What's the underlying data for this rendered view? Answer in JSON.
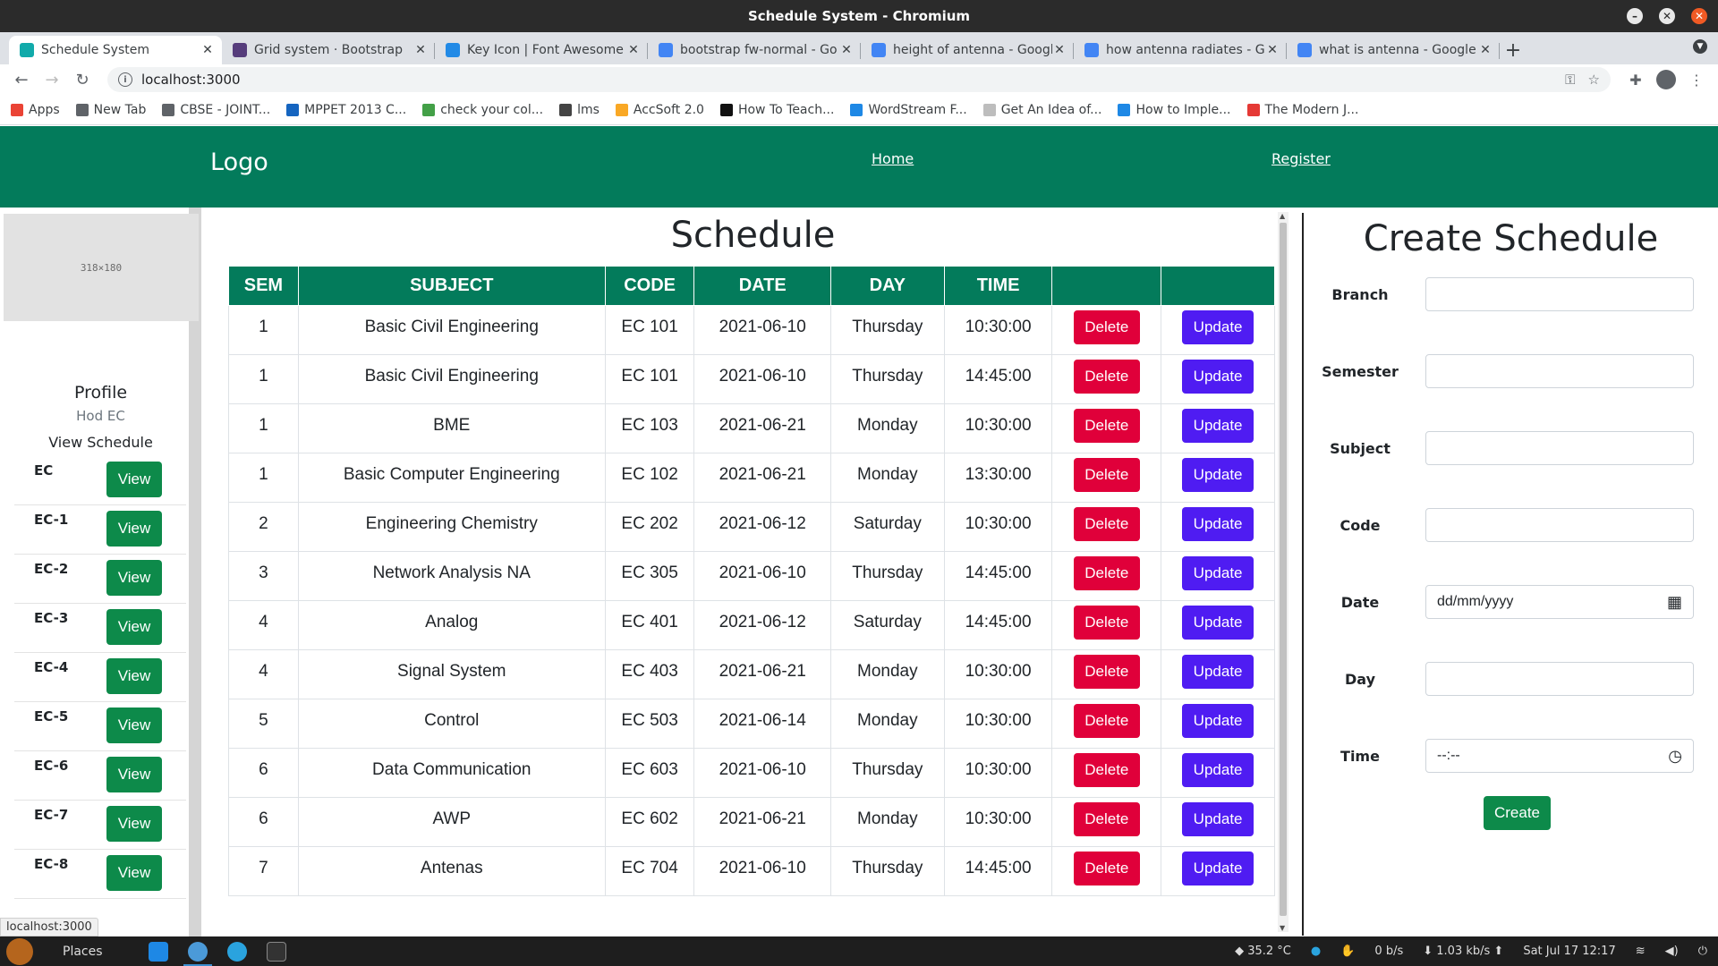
{
  "window": {
    "title": "Schedule System - Chromium"
  },
  "tabs": [
    {
      "label": "Schedule System",
      "favicon": "#1aa",
      "active": true
    },
    {
      "label": "Grid system · Bootstrap",
      "favicon": "#563d7c"
    },
    {
      "label": "Key Icon | Font Awesome",
      "favicon": "#228ae6"
    },
    {
      "label": "bootstrap fw-normal - Go",
      "favicon": "#4285f4"
    },
    {
      "label": "height of antenna - Googl",
      "favicon": "#4285f4"
    },
    {
      "label": "how antenna radiates - Go",
      "favicon": "#4285f4"
    },
    {
      "label": "what is antenna - Google",
      "favicon": "#4285f4"
    }
  ],
  "address": {
    "url": "localhost:3000"
  },
  "bookmarks": [
    {
      "label": "Apps",
      "color": "#ea4335"
    },
    {
      "label": "New Tab",
      "color": "#5f6368"
    },
    {
      "label": "CBSE - JOINT...",
      "color": "#5f6368"
    },
    {
      "label": "MPPET 2013 C...",
      "color": "#1565c0"
    },
    {
      "label": "check your col...",
      "color": "#43a047"
    },
    {
      "label": "lms",
      "color": "#444"
    },
    {
      "label": "AccSoft 2.0",
      "color": "#f9a825"
    },
    {
      "label": "How To Teach...",
      "color": "#111"
    },
    {
      "label": "WordStream F...",
      "color": "#1e88e5"
    },
    {
      "label": "Get An Idea of...",
      "color": "#bdbdbd"
    },
    {
      "label": "How to Imple...",
      "color": "#1e88e5"
    },
    {
      "label": "The Modern J...",
      "color": "#e53935"
    }
  ],
  "navbar": {
    "logo": "Logo",
    "home": "Home",
    "register": "Register"
  },
  "sidebar": {
    "placeholder": "318×180",
    "profile_title": "Profile",
    "profile_sub": "Hod EC",
    "view_schedule": "View Schedule",
    "items": [
      {
        "label": "EC",
        "button": "View"
      },
      {
        "label": "EC-1",
        "button": "View"
      },
      {
        "label": "EC-2",
        "button": "View"
      },
      {
        "label": "EC-3",
        "button": "View"
      },
      {
        "label": "EC-4",
        "button": "View"
      },
      {
        "label": "EC-5",
        "button": "View"
      },
      {
        "label": "EC-6",
        "button": "View"
      },
      {
        "label": "EC-7",
        "button": "View"
      },
      {
        "label": "EC-8",
        "button": "View"
      }
    ]
  },
  "schedule": {
    "title": "Schedule",
    "headers": [
      "SEM",
      "SUBJECT",
      "CODE",
      "DATE",
      "DAY",
      "TIME",
      "",
      ""
    ],
    "delete_label": "Delete",
    "update_label": "Update",
    "rows": [
      [
        "1",
        "Basic Civil Engineering",
        "EC 101",
        "2021-06-10",
        "Thursday",
        "10:30:00"
      ],
      [
        "1",
        "Basic Civil Engineering",
        "EC 101",
        "2021-06-10",
        "Thursday",
        "14:45:00"
      ],
      [
        "1",
        "BME",
        "EC 103",
        "2021-06-21",
        "Monday",
        "10:30:00"
      ],
      [
        "1",
        "Basic Computer Engineering",
        "EC 102",
        "2021-06-21",
        "Monday",
        "13:30:00"
      ],
      [
        "2",
        "Engineering Chemistry",
        "EC 202",
        "2021-06-12",
        "Saturday",
        "10:30:00"
      ],
      [
        "3",
        "Network Analysis NA",
        "EC 305",
        "2021-06-10",
        "Thursday",
        "14:45:00"
      ],
      [
        "4",
        "Analog",
        "EC 401",
        "2021-06-12",
        "Saturday",
        "14:45:00"
      ],
      [
        "4",
        "Signal System",
        "EC 403",
        "2021-06-21",
        "Monday",
        "10:30:00"
      ],
      [
        "5",
        "Control",
        "EC 503",
        "2021-06-14",
        "Monday",
        "10:30:00"
      ],
      [
        "6",
        "Data Communication",
        "EC 603",
        "2021-06-10",
        "Thursday",
        "10:30:00"
      ],
      [
        "6",
        "AWP",
        "EC 602",
        "2021-06-21",
        "Monday",
        "10:30:00"
      ],
      [
        "7",
        "Antenas",
        "EC 704",
        "2021-06-10",
        "Thursday",
        "14:45:00"
      ]
    ]
  },
  "form": {
    "title": "Create Schedule",
    "fields": [
      {
        "label": "Branch",
        "value": ""
      },
      {
        "label": "Semester",
        "value": ""
      },
      {
        "label": "Subject",
        "value": ""
      },
      {
        "label": "Code",
        "value": ""
      },
      {
        "label": "Date",
        "value": "dd/mm/yyyy",
        "icon": "calendar-icon"
      },
      {
        "label": "Day",
        "value": ""
      },
      {
        "label": "Time",
        "value": "--:--",
        "icon": "clock-icon"
      }
    ],
    "submit": "Create"
  },
  "status_tooltip": "localhost:3000",
  "taskbar": {
    "places": "Places",
    "temperature": "35.2 °C",
    "net_up": "0 b/s",
    "net_down": "1.03 kb/s",
    "clock": "Sat Jul 17  12:17"
  },
  "colors": {
    "navbar": "#037b5b",
    "view_btn": "#0d8a4a",
    "delete_btn": "#e0003a",
    "update_btn": "#4f1cf2"
  }
}
